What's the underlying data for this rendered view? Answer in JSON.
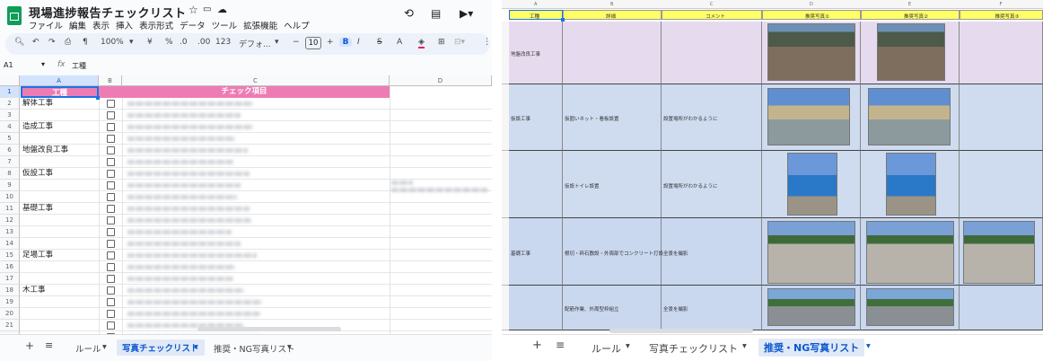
{
  "left": {
    "app_title": "現場進捗報告チェックリスト",
    "menu": [
      "ファイル",
      "編集",
      "表示",
      "挿入",
      "表示形式",
      "データ",
      "ツール",
      "拡張機能",
      "ヘルプ"
    ],
    "toolbar": {
      "zoom": "100%",
      "currency": "¥",
      "percent": "%",
      "dec_minus": ".0",
      "dec_plus": ".00",
      "format_123": "123",
      "font": "デフォ...",
      "font_size": "10",
      "bold": "B",
      "italic": "I",
      "text_color": "A"
    },
    "name_box": "A1",
    "formula_value": "工種",
    "columns": [
      "A",
      "B",
      "C",
      "D"
    ],
    "header_row": {
      "a": "工種",
      "c": "チェック項目"
    },
    "row_numbers": [
      "1",
      "2",
      "3",
      "4",
      "5",
      "6",
      "7",
      "8",
      "9",
      "10",
      "11",
      "12",
      "13",
      "14",
      "15",
      "16",
      "17",
      "18",
      "19",
      "20",
      "21",
      "22"
    ],
    "categories": {
      "r2": "解体工事",
      "r4": "造成工事",
      "r6": "地盤改良工事",
      "r8": "仮設工事",
      "r11": "基礎工事",
      "r15": "足場工事",
      "r18": "木工事"
    },
    "tabs": [
      "ルール",
      "写真チェックリスト",
      "推奨・NG写真リスト"
    ],
    "active_tab": "写真チェックリスト"
  },
  "right": {
    "column_letters": [
      "A",
      "B",
      "C",
      "D",
      "E",
      "F"
    ],
    "headers": [
      "工種",
      "詳細",
      "コメント",
      "推奨写真①",
      "推奨写真②",
      "推奨写真③"
    ],
    "rows": [
      {
        "a": "地盤改良工事",
        "b": "",
        "c": ""
      },
      {
        "a": "仮設工事",
        "b": "仮囲いネット・看板設置",
        "c": "設置場所がわかるように"
      },
      {
        "a": "",
        "b": "仮設トイレ設置",
        "c": "設置場所がわかるように"
      },
      {
        "a": "基礎工事",
        "b": "根切・砕石敷設・外周部でコンクリート打設",
        "c": "全景を撮影"
      },
      {
        "a": "",
        "b": "配筋作業、外周型枠組立",
        "c": "全景を撮影"
      }
    ],
    "tabs": [
      "ルール",
      "写真チェックリスト",
      "推奨・NG写真リスト"
    ],
    "active_tab": "推奨・NG写真リスト",
    "colors": {
      "header_yellow": "#ffff66",
      "lavender": "#e6dbee",
      "lightblue": "#cfdcf0",
      "tab_active": "#0b57d0"
    }
  }
}
